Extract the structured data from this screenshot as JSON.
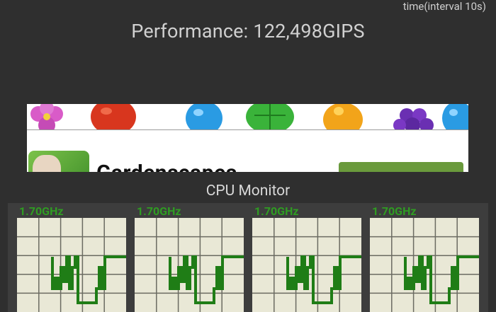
{
  "header": {
    "interval_note": "time(interval 10s)",
    "performance_text": "Performance: 122,498GIPS"
  },
  "ad": {
    "title": "Gardenscapes"
  },
  "cpu_monitor": {
    "title": "CPU Monitor",
    "cores": [
      {
        "freq": "1.70GHz"
      },
      {
        "freq": "1.70GHz"
      },
      {
        "freq": "1.70GHz"
      },
      {
        "freq": "1.70GHz"
      }
    ],
    "colors": {
      "graph_bg": "#e9e8d6",
      "grid": "#6b6b62",
      "line": "#1f7d16",
      "freq_text": "#2f9c22"
    }
  }
}
